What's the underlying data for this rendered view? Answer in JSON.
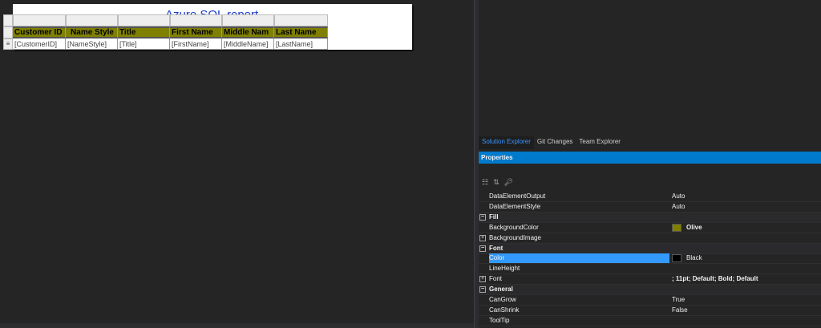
{
  "report": {
    "title": "Azure SQL report",
    "headers": [
      "Customer ID",
      "Name Style",
      "Title",
      "First Name",
      "Middle Nam",
      "Last Name"
    ],
    "fields": [
      "[CustomerID]",
      "[NameStyle]",
      "[Title]",
      "[FirstName]",
      "[MiddleName]",
      "[LastName]"
    ]
  },
  "tabs": [
    "Solution Explorer",
    "Git Changes",
    "Team Explorer"
  ],
  "properties": {
    "title": "Properties",
    "toolbar": [
      "categorized-icon",
      "alphabetical-icon",
      "property-pages-icon"
    ],
    "rows": [
      {
        "name": "DataElementOutput",
        "value": "Auto"
      },
      {
        "name": "DataElementStyle",
        "value": "Auto"
      },
      {
        "name": "Fill",
        "category": true
      },
      {
        "name": "BackgroundColor",
        "value": "Olive",
        "swatch": "#808000",
        "bold": true
      },
      {
        "name": "BackgroundImage",
        "value": "",
        "expandable": true
      },
      {
        "name": "Font",
        "category": true
      },
      {
        "name": "Color",
        "value": "Black",
        "swatch": "#000000",
        "selected": true
      },
      {
        "name": "LineHeight",
        "value": ""
      },
      {
        "name": "Font",
        "value": "; 11pt; Default; Bold; Default",
        "expandable": true,
        "bold": true
      },
      {
        "name": "General",
        "category": true
      },
      {
        "name": "CanGrow",
        "value": "True"
      },
      {
        "name": "CanShrink",
        "value": "False"
      },
      {
        "name": "ToolTip",
        "value": ""
      }
    ]
  },
  "colors": {
    "accent": "#007acc",
    "selection": "#3399ff",
    "header_fill": "#808000"
  }
}
